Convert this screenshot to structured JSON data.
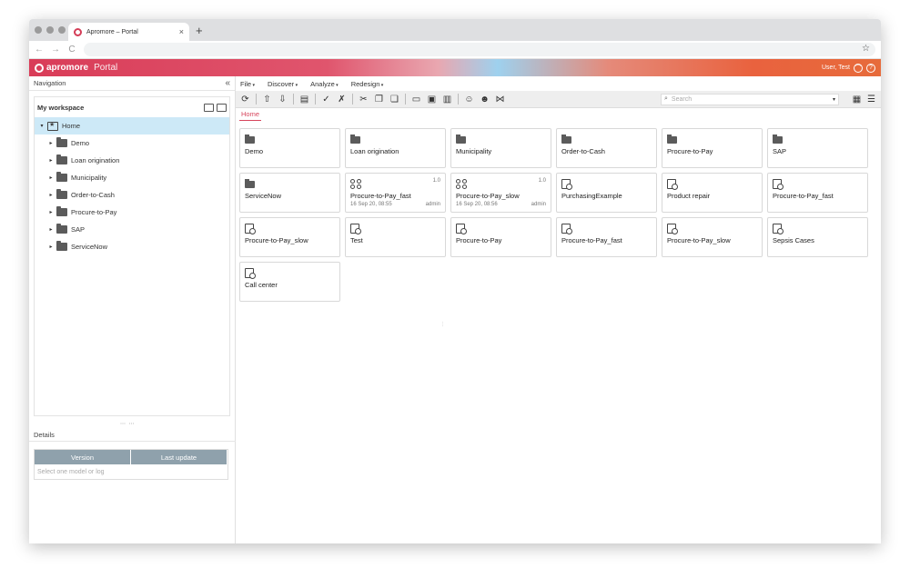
{
  "browser": {
    "tab_title": "Apromore – Portal",
    "tab_close": "×",
    "new_tab": "+",
    "back": "←",
    "forward": "→",
    "reload": "C",
    "bookmark": "☆"
  },
  "header": {
    "brand": "apromore",
    "product": "Portal",
    "user": "User, Test",
    "user_icon": "user-circle-icon",
    "help_icon": "?"
  },
  "navigation": {
    "title": "Navigation",
    "collapse": "«",
    "workspace_title": "My workspace",
    "tree": {
      "root": "Home",
      "items": [
        "Demo",
        "Loan origination",
        "Municipality",
        "Order-to-Cash",
        "Procure-to-Pay",
        "SAP",
        "ServiceNow"
      ]
    }
  },
  "details": {
    "title": "Details",
    "columns": [
      "Version",
      "Last update"
    ],
    "empty": "Select one model or log"
  },
  "menu": {
    "items": [
      "File",
      "Discover",
      "Analyze",
      "Redesign"
    ]
  },
  "search": {
    "placeholder": "Search"
  },
  "breadcrumb": "Home",
  "tiles": [
    {
      "type": "folder",
      "label": "Demo"
    },
    {
      "type": "folder",
      "label": "Loan origination"
    },
    {
      "type": "folder",
      "label": "Municipality"
    },
    {
      "type": "folder",
      "label": "Order-to-Cash"
    },
    {
      "type": "folder",
      "label": "Procure-to-Pay"
    },
    {
      "type": "folder",
      "label": "SAP"
    },
    {
      "type": "folder",
      "label": "ServiceNow"
    },
    {
      "type": "model",
      "label": "Procure-to-Pay_fast",
      "version": "1.0",
      "date": "16 Sep 20, 08:55",
      "owner": "admin"
    },
    {
      "type": "model",
      "label": "Procure-to-Pay_slow",
      "version": "1.0",
      "date": "16 Sep 20, 08:56",
      "owner": "admin"
    },
    {
      "type": "log",
      "label": "PurchasingExample"
    },
    {
      "type": "log",
      "label": "Product repair"
    },
    {
      "type": "log",
      "label": "Procure-to-Pay_fast"
    },
    {
      "type": "log",
      "label": "Procure-to-Pay_slow"
    },
    {
      "type": "log",
      "label": "Test"
    },
    {
      "type": "log",
      "label": "Procure-to-Pay"
    },
    {
      "type": "log",
      "label": "Procure-to-Pay_fast"
    },
    {
      "type": "log",
      "label": "Procure-to-Pay_slow"
    },
    {
      "type": "log",
      "label": "Sepsis Cases"
    },
    {
      "type": "log",
      "label": "Call center"
    }
  ],
  "colors": {
    "accent": "#d7455c",
    "selected_row": "#cde9f7",
    "table_header": "#8fa1ac"
  }
}
